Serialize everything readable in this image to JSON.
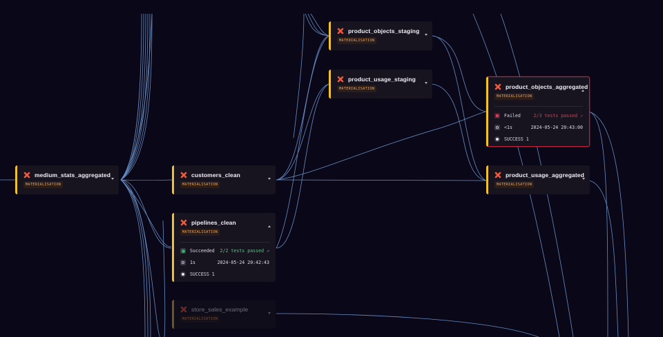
{
  "nodes": {
    "medium_stats_aggregated": {
      "title": "medium_stats_aggregated",
      "badge": "MATERIALISATION"
    },
    "customers_clean": {
      "title": "customers_clean",
      "badge": "MATERIALISATION"
    },
    "pipelines_clean": {
      "title": "pipelines_clean",
      "badge": "MATERIALISATION",
      "status": "Succeeded",
      "tests": "2/2 tests passed ↗",
      "duration": "1s",
      "timestamp": "2024-05-24 20:42:43",
      "result": "SUCCESS 1"
    },
    "store_sales_example": {
      "title": "store_sales_example",
      "badge": "MATERIALISATION"
    },
    "product_objects_staging": {
      "title": "product_objects_staging",
      "badge": "MATERIALISATION"
    },
    "product_usage_staging": {
      "title": "product_usage_staging",
      "badge": "MATERIALISATION"
    },
    "product_objects_aggregated": {
      "title": "product_objects_aggregated",
      "badge": "MATERIALISATION",
      "status": "Failed",
      "tests": "2/3 tests passed ↗",
      "duration": "<1s",
      "timestamp": "2024-05-24 20:43:00",
      "result": "SUCCESS 1"
    },
    "product_usage_aggregated": {
      "title": "product_usage_aggregated",
      "badge": "MATERIALISATION"
    }
  },
  "colors": {
    "background": "#0a0818",
    "node": "#17141f",
    "accent": "#f2c230",
    "edge": "#7fb0f0",
    "failed": "#c0223b",
    "success": "#3ecf7a"
  }
}
